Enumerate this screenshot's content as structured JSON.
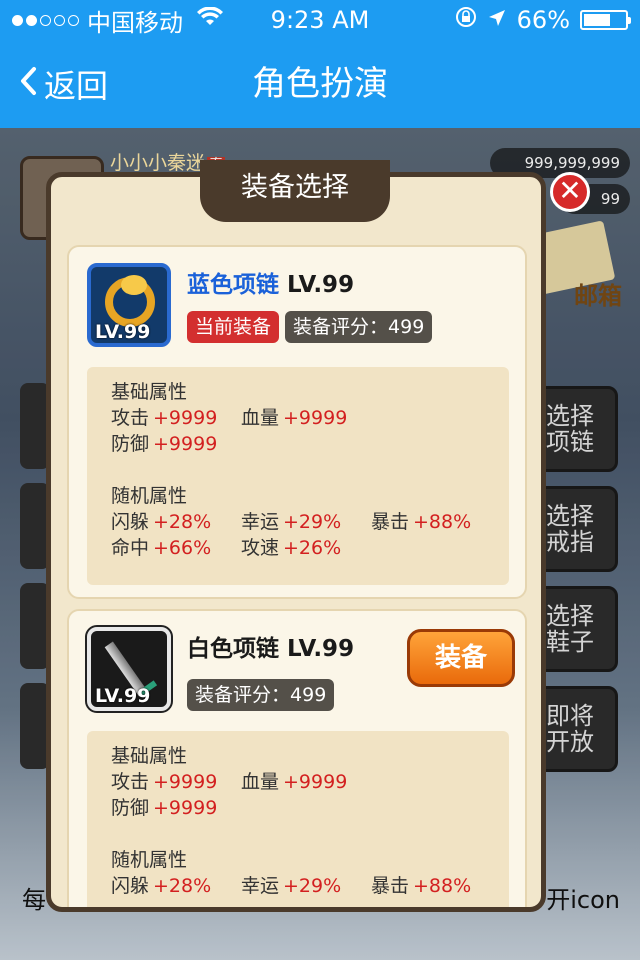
{
  "status_bar": {
    "carrier": "中国移动",
    "time": "9:23 AM",
    "battery": "66%",
    "battery_level": 0.66,
    "signal_dots_filled": 2,
    "signal_dots_total": 5
  },
  "nav": {
    "back_label": "返回",
    "title": "角色扮演"
  },
  "game": {
    "player_name": "小小小秦迷",
    "player_badge": "秦",
    "coins": "999,999,999",
    "coins2": "99",
    "mail_label": "邮箱",
    "side_buttons": [
      "选择\n项链",
      "选择\n戒指",
      "选择\n鞋子",
      "即将\n开放"
    ],
    "bottom_left_text": "每",
    "bottom_right_text": "开icon"
  },
  "modal": {
    "title": "装备选择",
    "close_label": "✕",
    "items": [
      {
        "name": "蓝色项链",
        "level": "LV.99",
        "icon_level": "LV.99",
        "current_badge": "当前装备",
        "score_label": "装备评分：",
        "score": "499",
        "base_title": "基础属性",
        "base": [
          {
            "k": "攻击",
            "v": "+9999"
          },
          {
            "k": "血量",
            "v": "+9999"
          },
          {
            "k": "防御",
            "v": "+9999"
          }
        ],
        "random_title": "随机属性",
        "random": [
          {
            "k": "闪躲",
            "v": "+28%"
          },
          {
            "k": "幸运",
            "v": "+29%"
          },
          {
            "k": "暴击",
            "v": "+88%"
          },
          {
            "k": "命中",
            "v": "+66%"
          },
          {
            "k": "攻速",
            "v": "+26%"
          }
        ]
      },
      {
        "name": "白色项链",
        "level": "LV.99",
        "icon_level": "LV.99",
        "equip_button": "装备",
        "score_label": "装备评分：",
        "score": "499",
        "base_title": "基础属性",
        "base": [
          {
            "k": "攻击",
            "v": "+9999"
          },
          {
            "k": "血量",
            "v": "+9999"
          },
          {
            "k": "防御",
            "v": "+9999"
          }
        ],
        "random_title": "随机属性",
        "random": [
          {
            "k": "闪躲",
            "v": "+28%"
          },
          {
            "k": "幸运",
            "v": "+29%"
          },
          {
            "k": "暴击",
            "v": "+88%"
          }
        ]
      }
    ]
  },
  "colors": {
    "nav_blue": "#1d9cf2",
    "modal_bg": "#f2e7cc",
    "modal_border": "#4a3a2b",
    "value_red": "#d32020",
    "badge_red": "#d32f2f",
    "equip_orange": "#f28a20"
  }
}
